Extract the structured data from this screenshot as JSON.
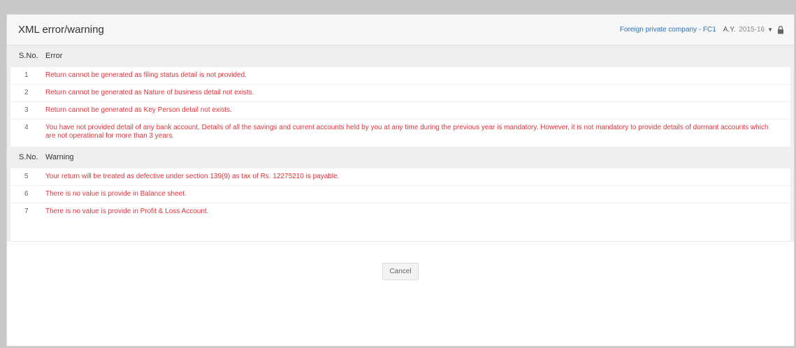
{
  "modal": {
    "title": "XML error/warning",
    "company": "Foreign private company - FC1",
    "ay_label": "A.Y.",
    "ay_value": "2015-16"
  },
  "errors": {
    "sno_header": "S.No.",
    "type_header": "Error",
    "rows": [
      {
        "sno": "1",
        "message": "Return cannot be generated as filing status detail is not provided."
      },
      {
        "sno": "2",
        "message": "Return cannot be generated as Nature of business detail not exists."
      },
      {
        "sno": "3",
        "message": "Return cannot be generated as Key Person detail not exists."
      },
      {
        "sno": "4",
        "message": "You have not provided detail of any bank account. Details of all the savings and current accounts held by you at any time during the previous year is mandatory. However, it is not mandatory to provide details of dormant accounts which are not operational for more than 3 years."
      }
    ]
  },
  "warnings": {
    "sno_header": "S.No.",
    "type_header": "Warning",
    "rows": [
      {
        "sno": "5",
        "message": "Your return will be treated as defective under section 139(9) as tax of Rs. 12275210 is payable."
      },
      {
        "sno": "6",
        "message": "There is no value is provide in Balance sheet."
      },
      {
        "sno": "7",
        "message": "There is no value is provide in Profit & Loss Account."
      }
    ]
  },
  "footer": {
    "cancel_label": "Cancel"
  },
  "colors": {
    "error_text": "#e0323c",
    "link": "#2a6fb0"
  }
}
